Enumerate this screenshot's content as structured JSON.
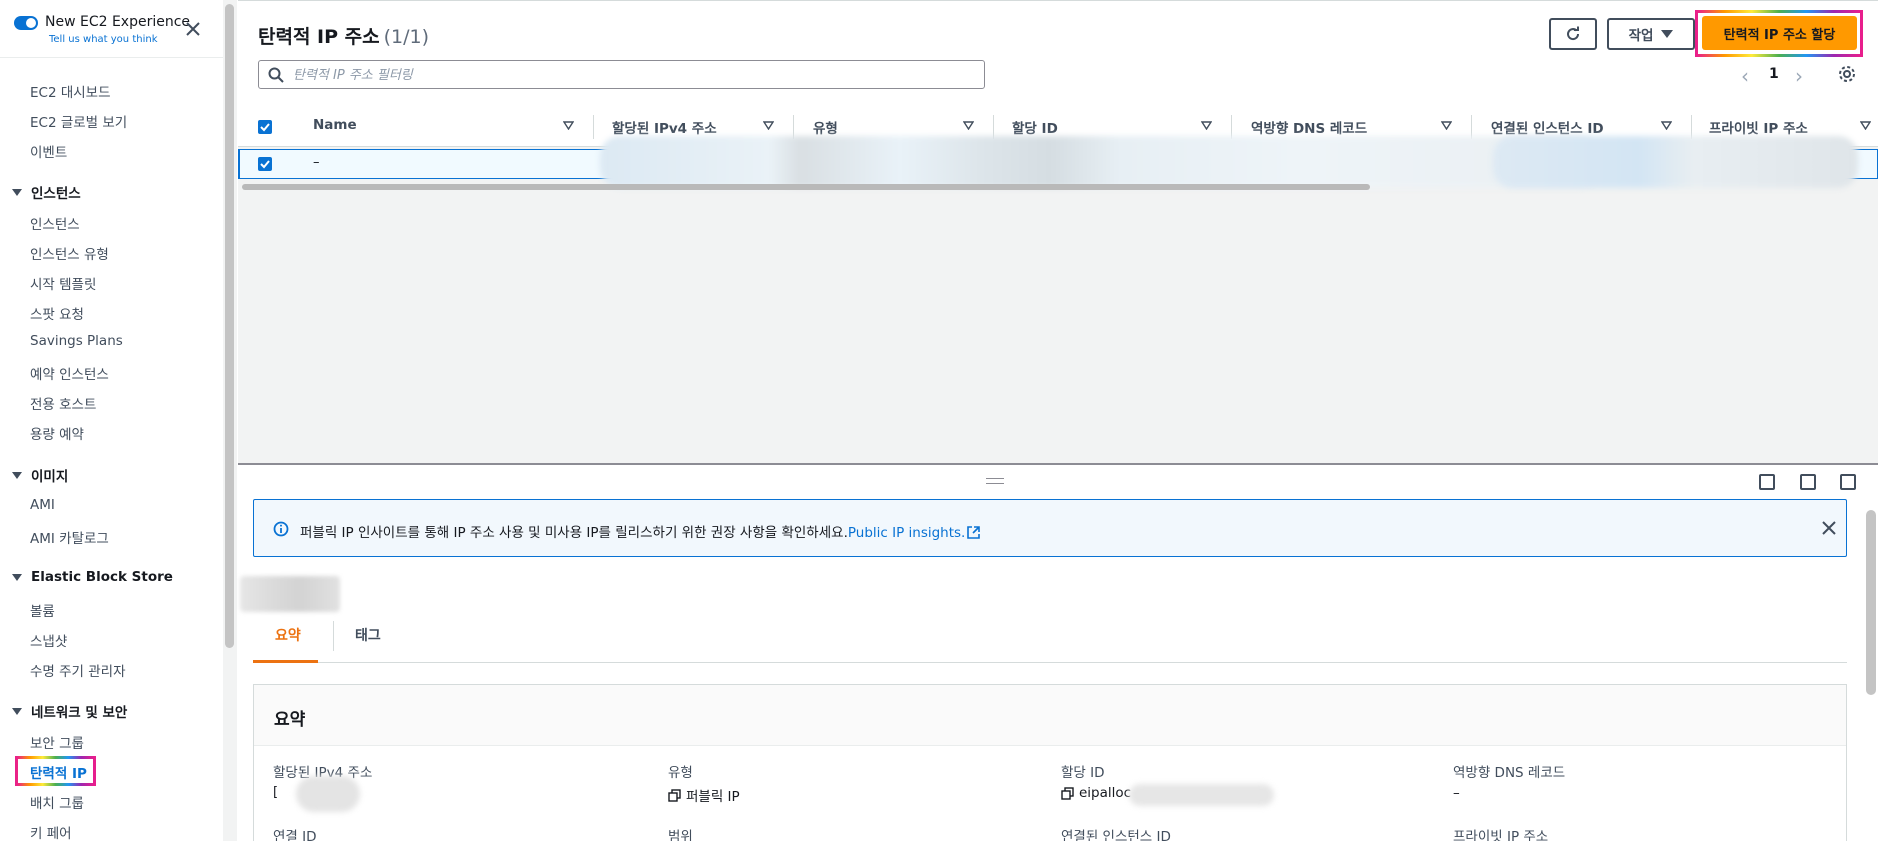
{
  "sidebar": {
    "title": "New EC2 Experience",
    "subtitle": "Tell us what you think",
    "items_top": [
      "EC2 대시보드",
      "EC2 글로벌 보기",
      "이벤트"
    ],
    "sections": [
      {
        "label": "인스턴스",
        "items": [
          "인스턴스",
          "인스턴스 유형",
          "시작 템플릿",
          "스팟 요청",
          "Savings Plans",
          "예약 인스턴스",
          "전용 호스트",
          "용량 예약"
        ]
      },
      {
        "label": "이미지",
        "items": [
          "AMI",
          "AMI 카탈로그"
        ]
      },
      {
        "label": "Elastic Block Store",
        "items": [
          "볼륨",
          "스냅샷",
          "수명 주기 관리자"
        ]
      },
      {
        "label": "네트워크 및 보안",
        "items": [
          "보안 그룹",
          "탄력적 IP",
          "배치 그룹",
          "키 페어"
        ]
      }
    ],
    "active_item": "탄력적 IP"
  },
  "header": {
    "title": "탄력적 IP 주소",
    "count": "(1/1)",
    "action_label": "작업",
    "primary_label": "탄력적 IP 주소 할당"
  },
  "filter": {
    "placeholder": "탄력적 IP 주소 필터링"
  },
  "pagination": {
    "page": "1"
  },
  "table": {
    "columns": [
      "Name",
      "할당된 IPv4 주소",
      "유형",
      "할당 ID",
      "역방향 DNS 레코드",
      "연결된 인스턴스 ID",
      "프라이빗 IP 주소"
    ],
    "row": {
      "name": "–"
    }
  },
  "info_banner": {
    "text": "퍼블릭 IP 인사이트를 통해 IP 주소 사용 및 미사용 IP를 릴리스하기 위한 권장 사항을 확인하세요.",
    "link": "Public IP insights."
  },
  "tabs": [
    "요약",
    "태그"
  ],
  "summary": {
    "title": "요약",
    "fields": [
      {
        "label": "할당된 IPv4 주소",
        "value": ""
      },
      {
        "label": "유형",
        "value": "퍼블릭 IP"
      },
      {
        "label": "할당 ID",
        "value": "eipalloc"
      },
      {
        "label": "역방향 DNS 레코드",
        "value": "–"
      },
      {
        "label": "연결 ID",
        "value": ""
      },
      {
        "label": "범위",
        "value": ""
      },
      {
        "label": "연결된 인스턴스 ID",
        "value": ""
      },
      {
        "label": "프라이빗 IP 주소",
        "value": ""
      }
    ]
  },
  "colors": {
    "accent": "#0972d3",
    "primary_button": "#ff9900",
    "active_tab": "#ec7211"
  },
  "icons": [
    "toggle-icon",
    "close-icon",
    "refresh-icon",
    "caret-down-icon",
    "search-icon",
    "chevron-left-icon",
    "chevron-right-icon",
    "gear-icon",
    "sort-icon",
    "checkbox-icon",
    "info-icon",
    "external-link-icon",
    "copy-icon",
    "panel-bottom-icon",
    "panel-side-icon",
    "panel-full-icon"
  ]
}
